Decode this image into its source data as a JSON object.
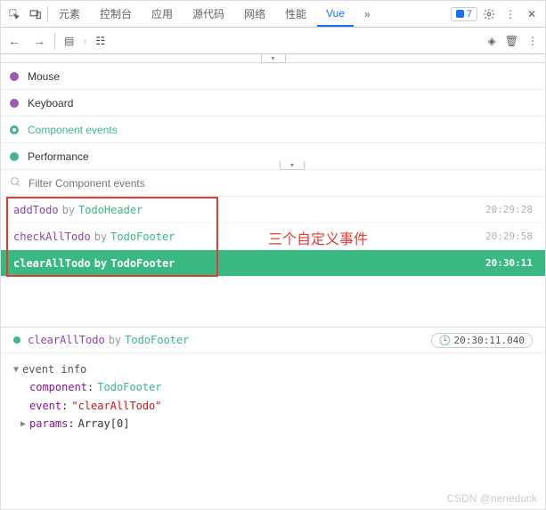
{
  "tabs": {
    "elements": "元素",
    "console": "控制台",
    "application": "应用",
    "sources": "源代码",
    "network": "网络",
    "performance": "性能",
    "vue": "Vue",
    "more": "»",
    "badge_count": "7"
  },
  "event_types": [
    {
      "label": "Mouse",
      "color": "#9b59b6",
      "kind": "dot"
    },
    {
      "label": "Keyboard",
      "color": "#9b59b6",
      "kind": "dot"
    },
    {
      "label": "Component events",
      "color": "#41b883",
      "kind": "ring",
      "active": true
    },
    {
      "label": "Performance",
      "color": "#41b883",
      "kind": "dot"
    }
  ],
  "filter": {
    "placeholder": "Filter Component events"
  },
  "events": [
    {
      "name": "addTodo",
      "by": "by",
      "component": "TodoHeader",
      "time": "20:29:28",
      "selected": false
    },
    {
      "name": "checkAllTodo",
      "by": "by",
      "component": "TodoFooter",
      "time": "20:29:58",
      "selected": false
    },
    {
      "name": "clearAllTodo",
      "by": "by",
      "component": "TodoFooter",
      "time": "20:30:11",
      "selected": true
    }
  ],
  "annotation": "三个自定义事件",
  "detail": {
    "name": "clearAllTodo",
    "by": "by",
    "component": "TodoFooter",
    "timestamp": "20:30:11.040",
    "section": "event info",
    "props": {
      "component_key": "component",
      "component_val": "TodoFooter",
      "event_key": "event",
      "event_val": "\"clearAllTodo\"",
      "params_key": "params",
      "params_val": "Array[0]"
    }
  },
  "watermark": "CSDN @neneduck"
}
